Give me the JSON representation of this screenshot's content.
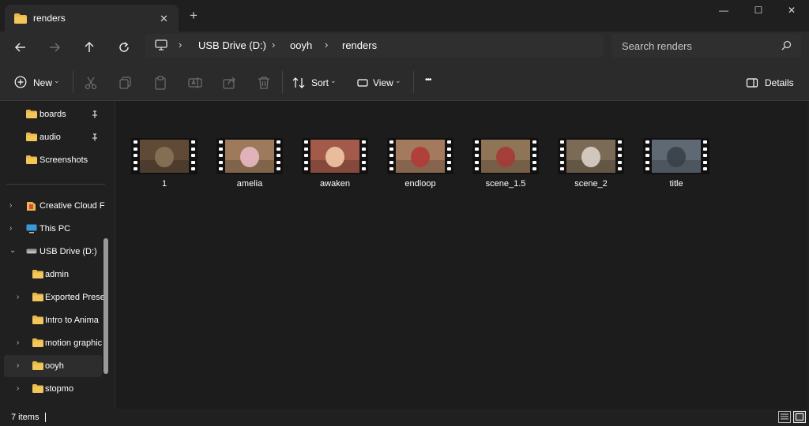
{
  "window": {
    "tab_title": "renders",
    "tab_close": "✕",
    "new_tab": "+",
    "minimize": "—",
    "maximize": "☐",
    "close": "✕"
  },
  "nav": {
    "breadcrumbs": [
      "USB Drive (D:)",
      "ooyh",
      "renders"
    ],
    "separator": "›",
    "search_placeholder": "Search renders"
  },
  "commands": {
    "new_label": "New",
    "sort_label": "Sort",
    "view_label": "View",
    "more_label": "•••",
    "details_label": "Details"
  },
  "sidebar": {
    "pinned": [
      {
        "label": "boards",
        "pinned": true
      },
      {
        "label": "audio",
        "pinned": true
      },
      {
        "label": "Screenshots",
        "pinned": false
      }
    ],
    "tree": [
      {
        "label": "Creative Cloud F",
        "icon": "creative-cloud-icon",
        "expanded": false
      },
      {
        "label": "This PC",
        "icon": "pc-icon",
        "expanded": false
      },
      {
        "label": "USB Drive (D:)",
        "icon": "drive-icon",
        "expanded": true
      },
      {
        "label": "admin",
        "icon": "folder-icon",
        "child": true,
        "chevron": false
      },
      {
        "label": "Exported Prese",
        "icon": "folder-icon",
        "child": true,
        "chevron": true
      },
      {
        "label": "Intro to Anima",
        "icon": "folder-icon",
        "child": true,
        "chevron": false
      },
      {
        "label": "motion graphic",
        "icon": "folder-icon",
        "child": true,
        "chevron": true
      },
      {
        "label": "ooyh",
        "icon": "folder-icon",
        "child": true,
        "chevron": true,
        "selected": true
      },
      {
        "label": "stopmo",
        "icon": "folder-icon",
        "child": true,
        "chevron": true
      }
    ]
  },
  "files": [
    {
      "name": "1",
      "bg": "#5e4a37",
      "accent": "#8a7358"
    },
    {
      "name": "amelia",
      "bg": "#9c7a5b",
      "accent": "#e9b8c4"
    },
    {
      "name": "awaken",
      "bg": "#a35a4a",
      "accent": "#f1c6a4"
    },
    {
      "name": "endloop",
      "bg": "#a47a5e",
      "accent": "#b23a37"
    },
    {
      "name": "scene_1.5",
      "bg": "#8f7457",
      "accent": "#a63a36"
    },
    {
      "name": "scene_2",
      "bg": "#7b6a55",
      "accent": "#d9d3c9"
    },
    {
      "name": "title",
      "bg": "#5f6973",
      "accent": "#3b4048"
    }
  ],
  "status": {
    "item_count": "7 items"
  },
  "colors": {
    "folder": "#e8b84c",
    "folder_dark": "#c99a33"
  }
}
